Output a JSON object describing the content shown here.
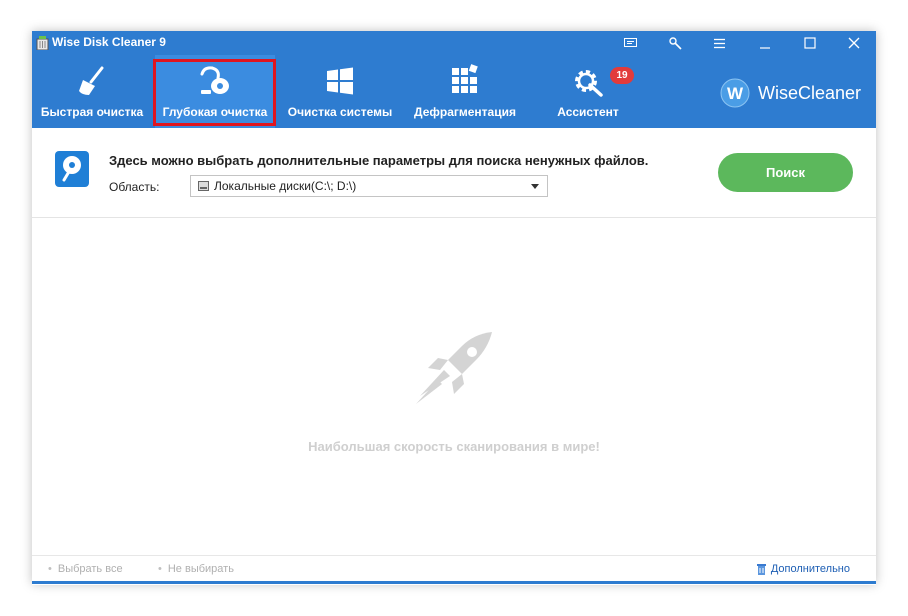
{
  "window": {
    "title": "Wise Disk Cleaner 9",
    "accent_color": "#2e7cd0",
    "controls": [
      "feedback-icon",
      "tools-icon",
      "menu-icon",
      "minimize-icon",
      "maximize-icon",
      "close-icon"
    ]
  },
  "tabs": [
    {
      "label": "Быстрая очистка",
      "icon": "broom-icon",
      "active": false
    },
    {
      "label": "Глубокая очистка",
      "icon": "vacuum-icon",
      "active": true
    },
    {
      "label": "Очистка системы",
      "icon": "windows-icon",
      "active": false
    },
    {
      "label": "Дефрагментация",
      "icon": "defrag-icon",
      "active": false
    },
    {
      "label": "Ассистент",
      "icon": "gear-wrench-icon",
      "active": false
    }
  ],
  "assistant_badge": "19",
  "brand": {
    "name": "WiseCleaner",
    "logo_letter": "W"
  },
  "panel": {
    "description": "Здесь можно выбрать дополнительные параметры для поиска ненужных файлов.",
    "area_label": "Область:",
    "area_value": "Локальные диски(C:\\; D:\\)",
    "search_button": "Поиск",
    "search_button_color": "#5cb85c"
  },
  "main": {
    "tagline": "Наибольшая скорость сканирования в мире!"
  },
  "footer": {
    "select_all": "Выбрать все",
    "select_none": "Не выбирать",
    "more": "Дополнительно"
  },
  "highlight_color": "#e0151f"
}
